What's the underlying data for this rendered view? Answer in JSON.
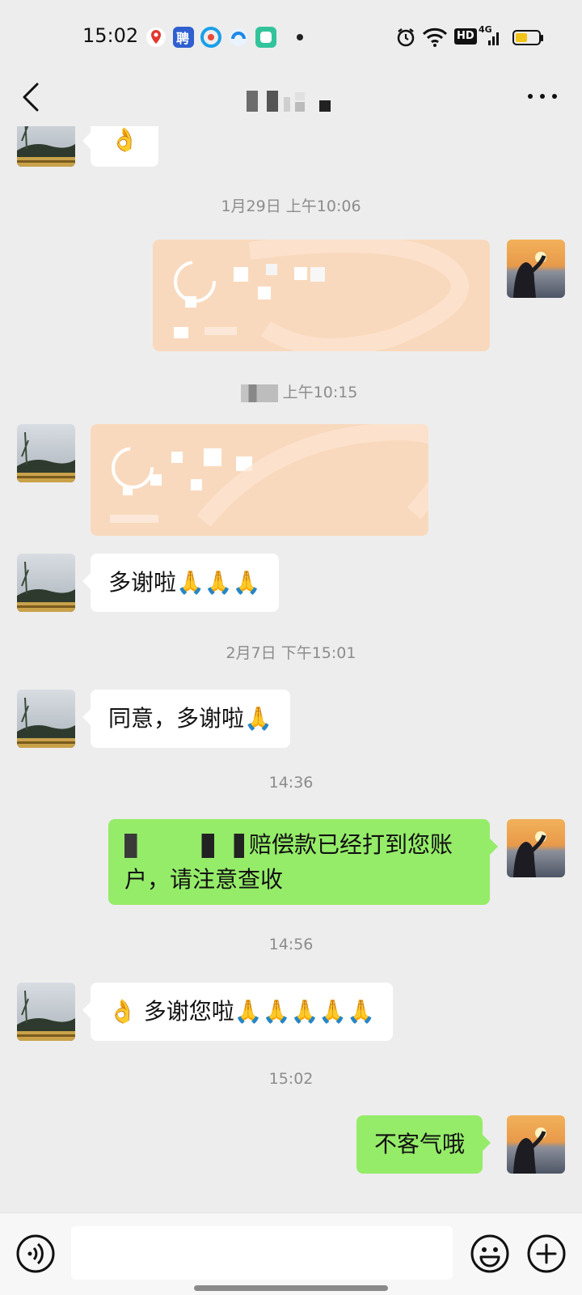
{
  "status_bar": {
    "time": "15:02",
    "hd_label": "HD",
    "network_label": "4G"
  },
  "header": {
    "back_icon": "chevron-left-icon",
    "more_icon": "ellipsis-icon"
  },
  "messages": [
    {
      "side": "left",
      "text": "👌"
    },
    {
      "timestamp": "1月29日 上午10:06"
    },
    {
      "side": "right",
      "type": "transfer"
    },
    {
      "timestamp": "上午10:15"
    },
    {
      "side": "left",
      "type": "transfer"
    },
    {
      "side": "left",
      "text": "多谢啦🙏🙏🙏"
    },
    {
      "timestamp": "2月7日 下午15:01"
    },
    {
      "side": "left",
      "text": "同意，多谢啦🙏"
    },
    {
      "timestamp": "14:36"
    },
    {
      "side": "right",
      "line1": "赔偿款已经打到您账",
      "line2": "户，请注意查收"
    },
    {
      "timestamp": "14:56"
    },
    {
      "side": "left",
      "text": "👌 多谢您啦🙏🙏🙏🙏🙏"
    },
    {
      "timestamp": "15:02"
    },
    {
      "side": "right",
      "text": "不客气哦"
    }
  ],
  "input_bar": {
    "voice_icon": "voice-icon",
    "emoji_icon": "emoji-icon",
    "plus_icon": "plus-icon",
    "placeholder": ""
  }
}
